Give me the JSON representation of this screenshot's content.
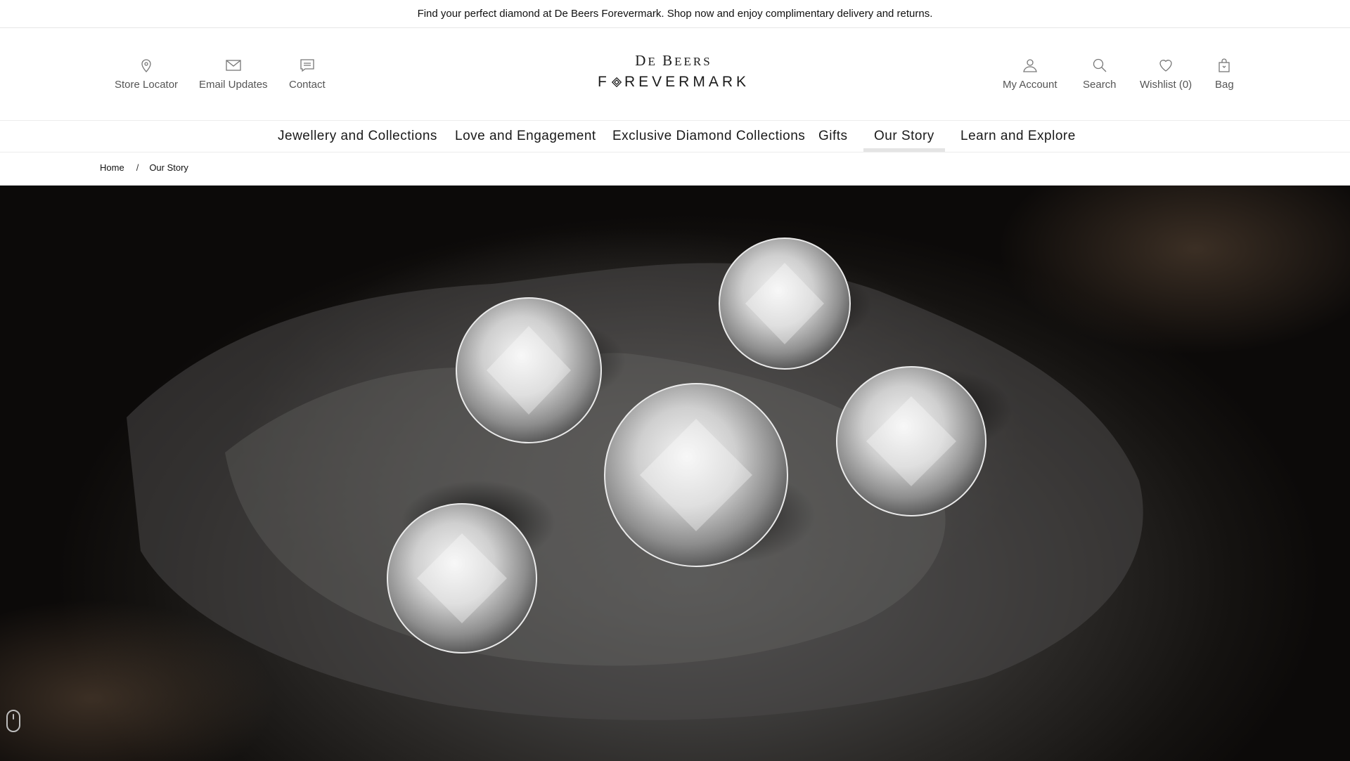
{
  "announcement": "Find your perfect diamond at De Beers Forevermark. Shop now and enjoy complimentary delivery and returns.",
  "header": {
    "left_links": [
      {
        "label": "Store Locator",
        "icon": "map-pin-icon"
      },
      {
        "label": "Email Updates",
        "icon": "envelope-icon"
      },
      {
        "label": "Contact",
        "icon": "chat-icon"
      }
    ],
    "logo": {
      "line1_a": "D",
      "line1_b": "E ",
      "line1_c": "B",
      "line1_d": "EERS",
      "line2_a": "F",
      "line2_b": "REVERMARK"
    },
    "right_links": [
      {
        "label": "My Account",
        "icon": "user-icon"
      },
      {
        "label": "Search",
        "icon": "search-icon"
      },
      {
        "label": "Wishlist (0)",
        "icon": "heart-icon"
      },
      {
        "label": "Bag",
        "icon": "bag-icon"
      }
    ]
  },
  "nav": {
    "items": [
      "Jewellery and Collections",
      "Love and Engagement",
      "Exclusive Diamond Collections",
      "Gifts",
      "Our Story",
      "Learn and Explore"
    ],
    "active": "Our Story"
  },
  "breadcrumb": {
    "home": "Home",
    "separator": "/",
    "current": "Our Story"
  },
  "hero": {
    "image": "round-brilliant-diamonds-on-rock"
  },
  "colors": {
    "text": "#1a1a1a",
    "muted": "#555555",
    "active_underline": "#e4e4e4"
  }
}
